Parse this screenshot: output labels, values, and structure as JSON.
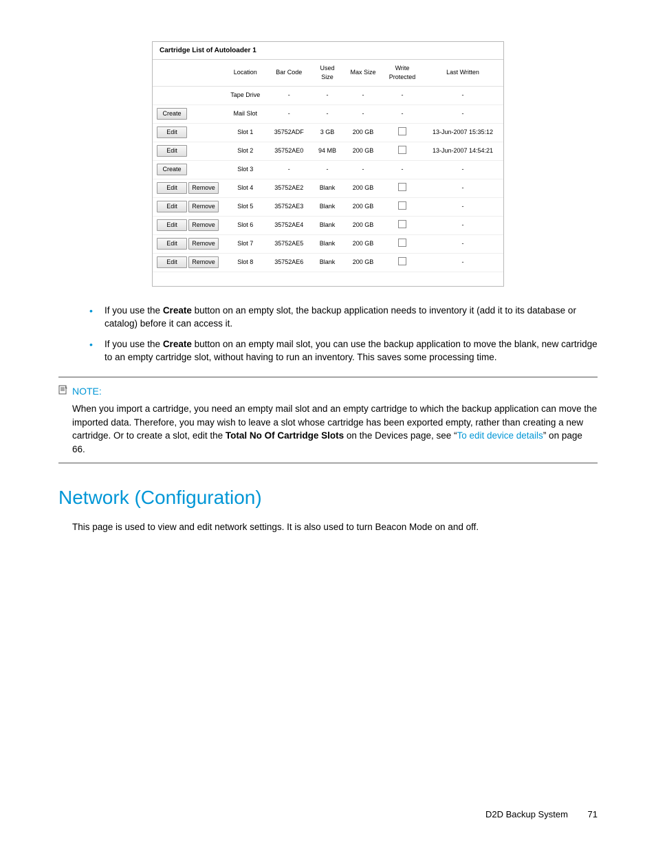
{
  "panel": {
    "title": "Cartridge List of Autoloader 1",
    "headers": [
      "Location",
      "Bar Code",
      "Used Size",
      "Max Size",
      "Write Protected",
      "Last Written"
    ],
    "labels": {
      "create": "Create",
      "edit": "Edit",
      "remove": "Remove"
    },
    "rows": [
      {
        "actions": [],
        "location": "Tape Drive",
        "barcode": "-",
        "used": "-",
        "max": "-",
        "wp": "-",
        "last": "-"
      },
      {
        "actions": [
          "create"
        ],
        "location": "Mail Slot",
        "barcode": "-",
        "used": "-",
        "max": "-",
        "wp": "-",
        "last": "-"
      },
      {
        "actions": [
          "edit"
        ],
        "location": "Slot 1",
        "barcode": "35752ADF",
        "used": "3 GB",
        "max": "200 GB",
        "wp": "chk",
        "last": "13-Jun-2007 15:35:12"
      },
      {
        "actions": [
          "edit"
        ],
        "location": "Slot 2",
        "barcode": "35752AE0",
        "used": "94 MB",
        "max": "200 GB",
        "wp": "chk",
        "last": "13-Jun-2007 14:54:21"
      },
      {
        "actions": [
          "create"
        ],
        "location": "Slot 3",
        "barcode": "-",
        "used": "-",
        "max": "-",
        "wp": "-",
        "last": "-"
      },
      {
        "actions": [
          "edit",
          "remove"
        ],
        "location": "Slot 4",
        "barcode": "35752AE2",
        "used": "Blank",
        "max": "200 GB",
        "wp": "chk",
        "last": "-"
      },
      {
        "actions": [
          "edit",
          "remove"
        ],
        "location": "Slot 5",
        "barcode": "35752AE3",
        "used": "Blank",
        "max": "200 GB",
        "wp": "chk",
        "last": "-"
      },
      {
        "actions": [
          "edit",
          "remove"
        ],
        "location": "Slot 6",
        "barcode": "35752AE4",
        "used": "Blank",
        "max": "200 GB",
        "wp": "chk",
        "last": "-"
      },
      {
        "actions": [
          "edit",
          "remove"
        ],
        "location": "Slot 7",
        "barcode": "35752AE5",
        "used": "Blank",
        "max": "200 GB",
        "wp": "chk",
        "last": "-"
      },
      {
        "actions": [
          "edit",
          "remove"
        ],
        "location": "Slot 8",
        "barcode": "35752AE6",
        "used": "Blank",
        "max": "200 GB",
        "wp": "chk",
        "last": "-"
      }
    ]
  },
  "bullets": {
    "b1_pre": "If you use the ",
    "b1_bold": "Create",
    "b1_post": " button on an empty slot, the backup application needs to inventory it (add it to its database or catalog) before it can access it.",
    "b2_pre": "If you use the ",
    "b2_bold": "Create",
    "b2_post": " button on an empty mail slot, you can use the backup application to move the blank, new cartridge to an empty cartridge slot, without having to run an inventory. This saves some processing time."
  },
  "note": {
    "label": "NOTE:",
    "t1": "When you import a cartridge, you need an empty mail slot and an empty cartridge to which the backup application can move the imported data. Therefore, you may wish to leave a slot whose cartridge has been exported empty, rather than creating a new cartridge. Or to create a slot, edit the ",
    "b1": "Total No Of Cartridge Slots",
    "t2": " on the Devices page, see “",
    "link": "To edit device details",
    "t3": "” on page 66."
  },
  "section": {
    "heading": "Network (Configuration)",
    "intro": "This page is used to view and edit network settings. It is also used to turn Beacon Mode on and off."
  },
  "footer": {
    "product": "D2D Backup System",
    "page": "71"
  }
}
